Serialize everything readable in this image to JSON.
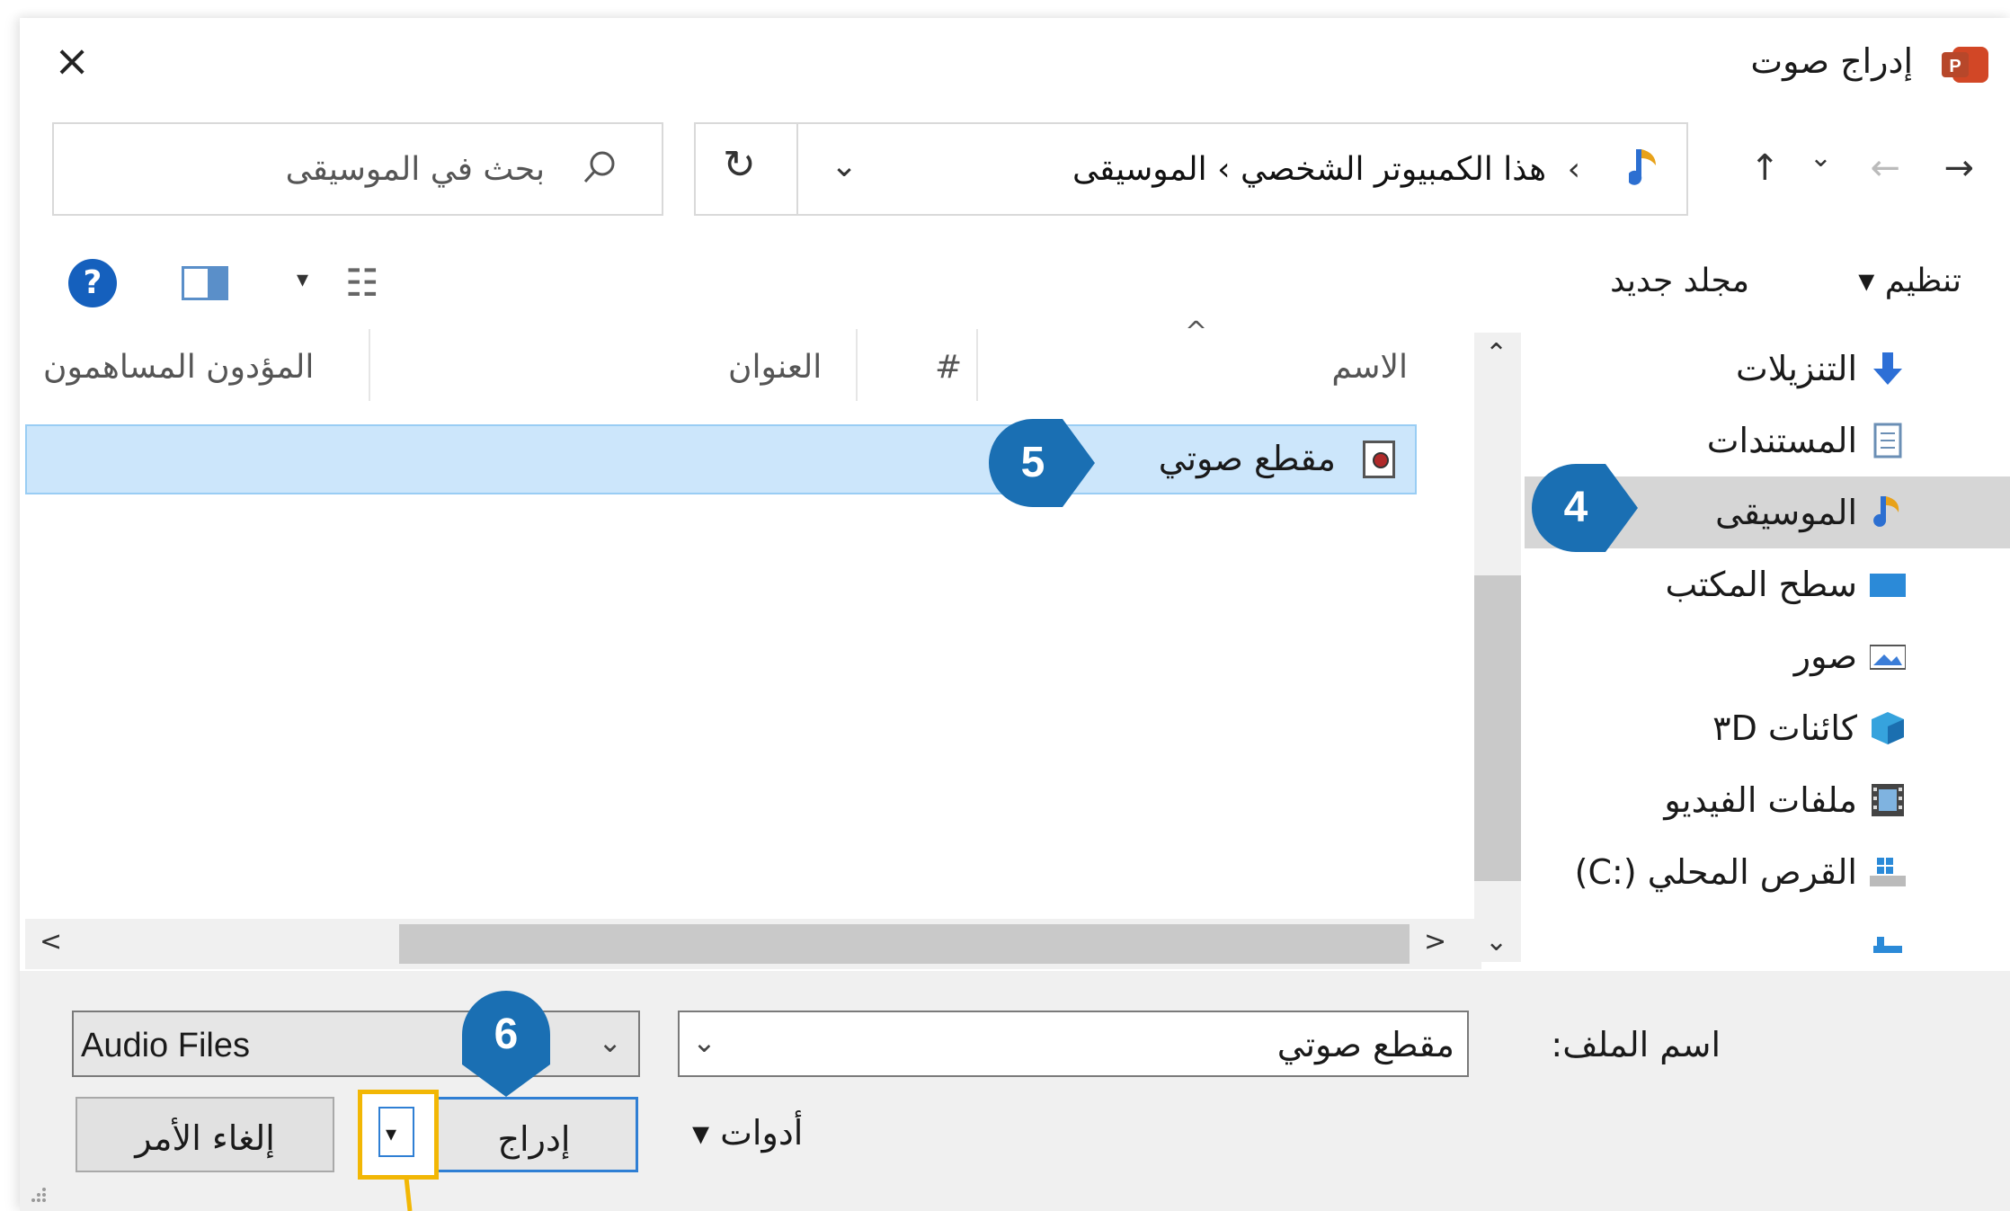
{
  "window": {
    "title": "إدراج صوت",
    "close_glyph": "×"
  },
  "navigation": {
    "back": "→",
    "forward": "←",
    "recent": "⌄",
    "up": "↑"
  },
  "address": {
    "path": "هذا الكمبيوتر الشخصي  ›  الموسيقى",
    "prefix_separator": "›",
    "dropdown": "⌄",
    "refresh_glyph": "↻"
  },
  "search": {
    "placeholder": "بحث في الموسيقى"
  },
  "toolbar": {
    "organize_label": "تنظيم ▾",
    "new_folder_label": "مجلد جديد",
    "help_glyph": "?",
    "view_dropdown": "▾",
    "view_glyph": "☷"
  },
  "nav_pane": {
    "items": [
      {
        "label": "التنزيلات",
        "icon": "download-icon",
        "selected": false
      },
      {
        "label": "المستندات",
        "icon": "documents-icon",
        "selected": false
      },
      {
        "label": "الموسيقى",
        "icon": "music-icon",
        "selected": true
      },
      {
        "label": "سطح المكتب",
        "icon": "desktop-icon",
        "selected": false
      },
      {
        "label": "صور",
        "icon": "pictures-icon",
        "selected": false
      },
      {
        "label": "كائنات ٣D",
        "icon": "3d-objects-icon",
        "selected": false
      },
      {
        "label": "ملفات الفيديو",
        "icon": "video-icon",
        "selected": false
      },
      {
        "label": "القرص المحلي (:C)",
        "icon": "drive-icon",
        "selected": false
      }
    ],
    "scroll_up": "⌃",
    "scroll_down": "⌄"
  },
  "columns": {
    "name": "الاسم",
    "number": "#",
    "title": "العنوان",
    "contributing_artists": "المؤدون المساهمون",
    "sort_indicator": "^"
  },
  "files": [
    {
      "name": "مقطع صوتي",
      "selected": true
    }
  ],
  "hscroll": {
    "left": "<",
    "right": ">"
  },
  "bottom": {
    "filename_label": "اسم الملف:",
    "filename_value": "مقطع صوتي",
    "filename_dropdown": "⌄",
    "filetype_value": "Audio Files",
    "filetype_dropdown": "⌄",
    "tools_label": "أدوات  ▾",
    "insert_label": "إدراج",
    "insert_split_arrow": "▾",
    "cancel_label": "إلغاء الأمر"
  },
  "callouts": {
    "step4": "4",
    "step5": "5",
    "step6": "6",
    "color": "#1a6fb3",
    "highlight_color": "#f2b705"
  }
}
